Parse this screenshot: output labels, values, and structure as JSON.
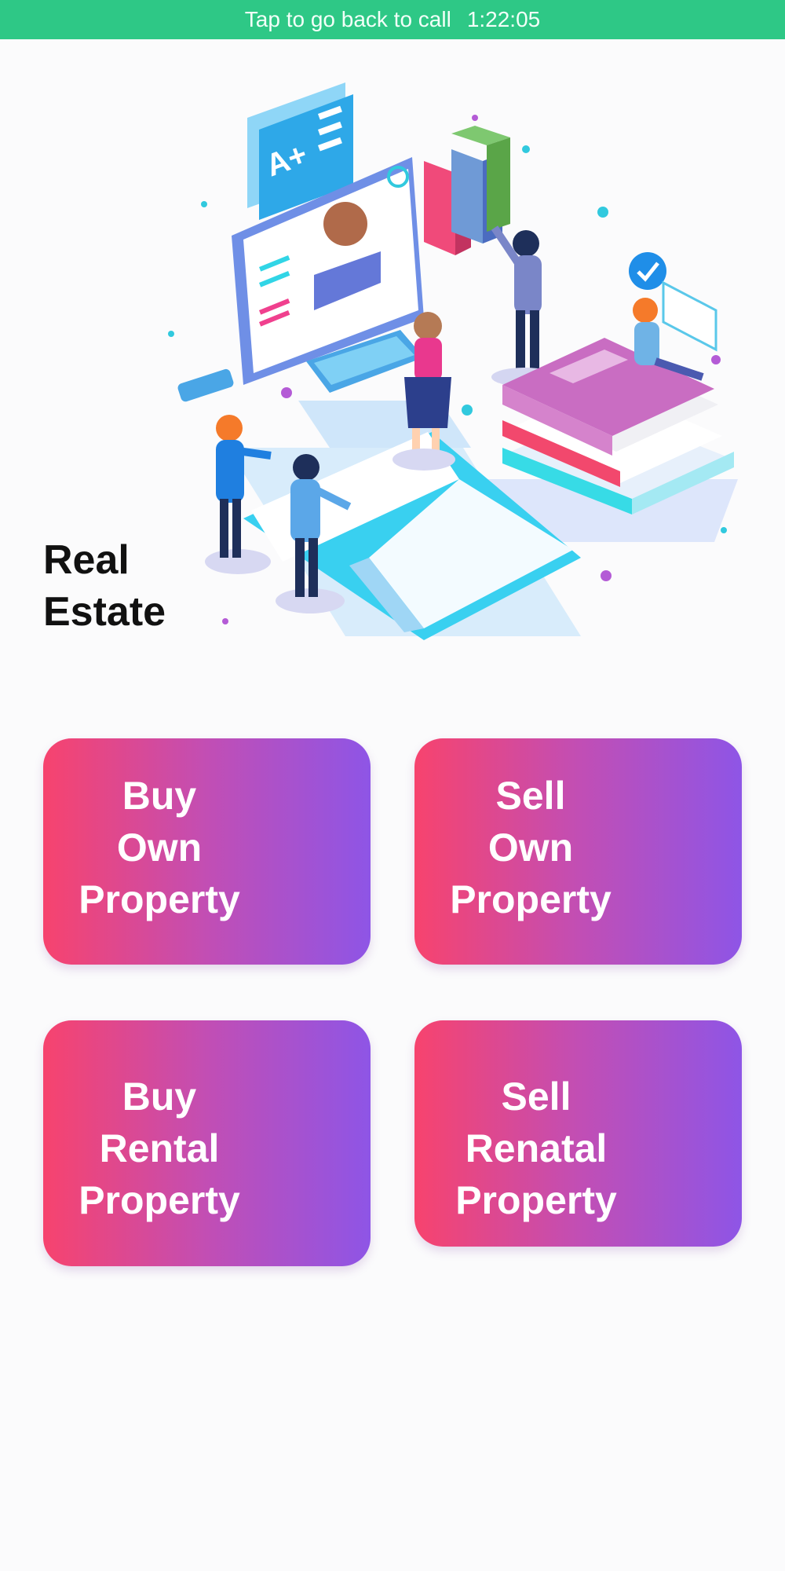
{
  "call_bar": {
    "text": "Tap to go back to call",
    "timer": "1:22:05",
    "color": "#2ec886"
  },
  "hero": {
    "title": "Real\nEstate",
    "badge_text": "A+",
    "illustration_icon": "education-isometric-illustration"
  },
  "tiles": [
    {
      "label": "Buy\nOwn\nProperty"
    },
    {
      "label": "Sell\nOwn\nProperty"
    },
    {
      "label": "Buy\nRental\nProperty"
    },
    {
      "label": "Sell\nRenatal\nProperty"
    }
  ],
  "colors": {
    "gradient_start": "#f7436e",
    "gradient_end": "#8e55e6"
  }
}
